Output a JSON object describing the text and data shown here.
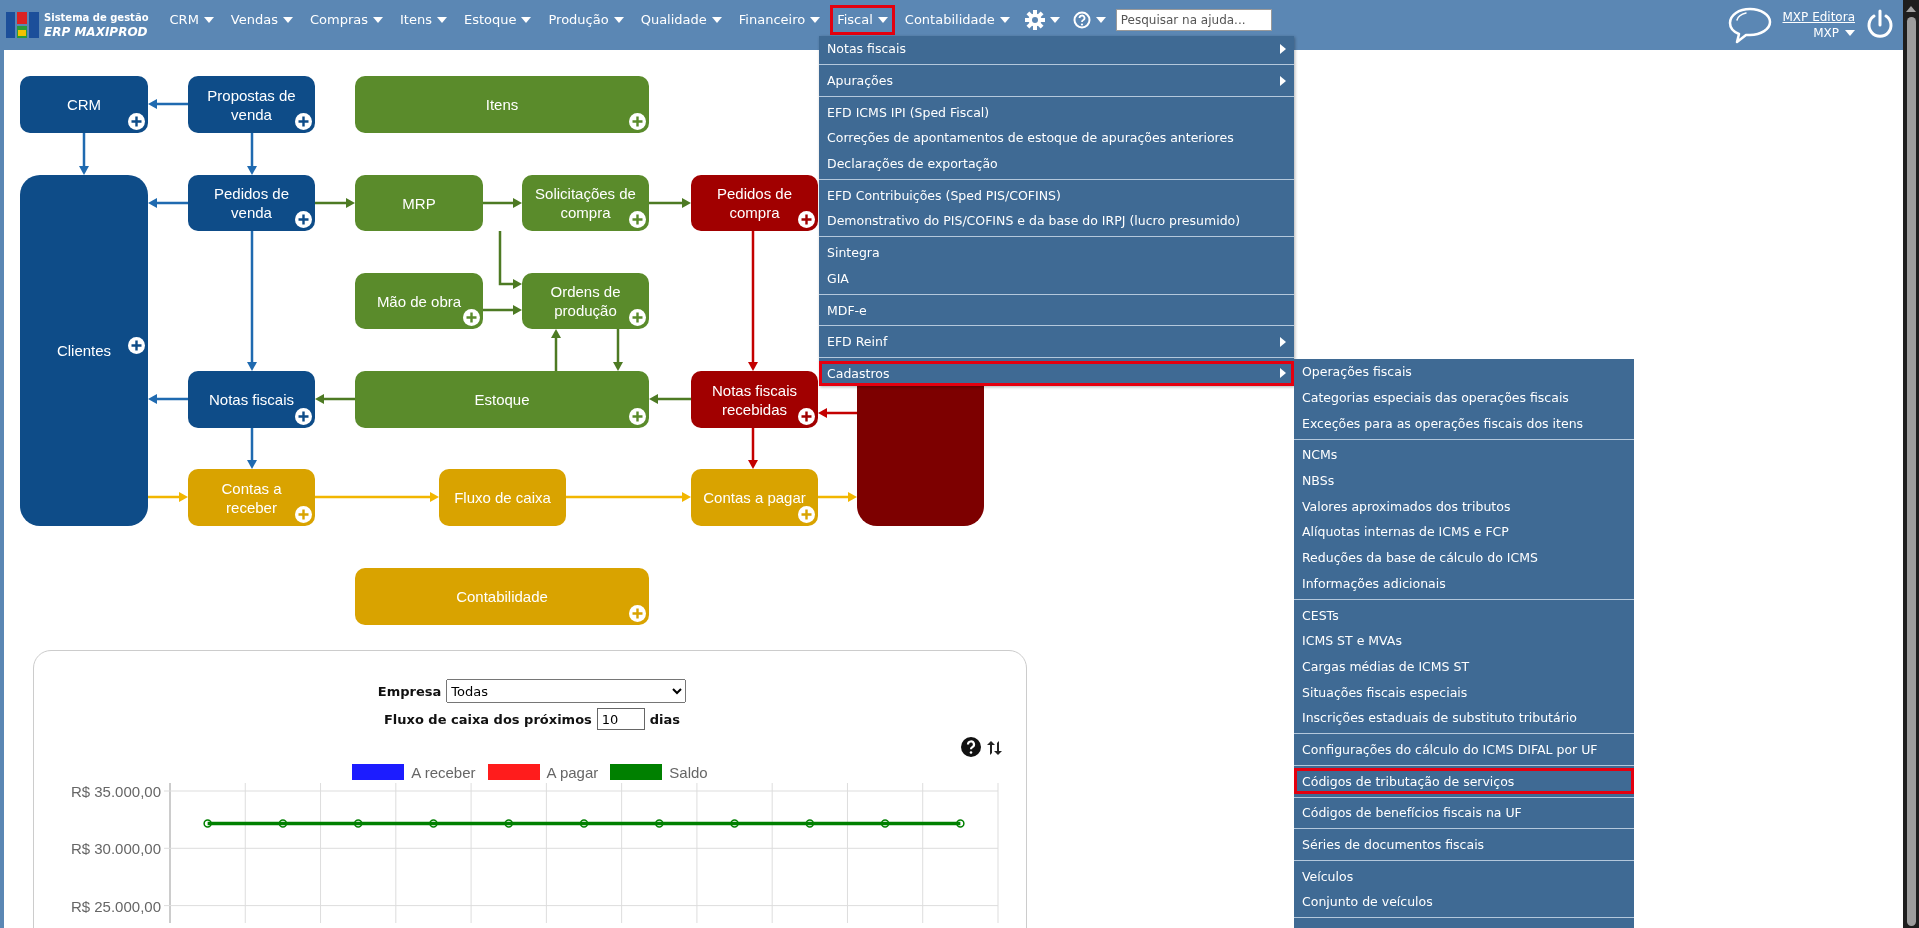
{
  "logo": {
    "subtitle": "Sistema de gestão",
    "title": "ERP MAXIPROD"
  },
  "nav": [
    {
      "label": "CRM",
      "selected": false
    },
    {
      "label": "Vendas",
      "selected": false
    },
    {
      "label": "Compras",
      "selected": false
    },
    {
      "label": "Itens",
      "selected": false
    },
    {
      "label": "Estoque",
      "selected": false
    },
    {
      "label": "Produção",
      "selected": false
    },
    {
      "label": "Qualidade",
      "selected": false
    },
    {
      "label": "Financeiro",
      "selected": false
    },
    {
      "label": "Fiscal",
      "selected": true
    },
    {
      "label": "Contabilidade",
      "selected": false
    }
  ],
  "search": {
    "placeholder": "Pesquisar na ajuda..."
  },
  "user": {
    "name": "MXP Editora",
    "company": "MXP"
  },
  "nodes": [
    {
      "label": "CRM",
      "color": "#0e4c88",
      "add": true
    },
    {
      "label": "Propostas de venda",
      "color": "#0e4c88",
      "add": true
    },
    {
      "label": "Itens",
      "color": "#5a8b2b",
      "add": true
    },
    {
      "label": "Clientes",
      "color": "#0e4c88",
      "add": true
    },
    {
      "label": "Pedidos de venda",
      "color": "#0e4c88",
      "add": true
    },
    {
      "label": "MRP",
      "color": "#5a8b2b",
      "add": false
    },
    {
      "label": "Solicitações de compra",
      "color": "#5a8b2b",
      "add": true
    },
    {
      "label": "Pedidos de compra",
      "color": "#a10000",
      "add": true
    },
    {
      "label": "Mão de obra",
      "color": "#5a8b2b",
      "add": true
    },
    {
      "label": "Ordens de produção",
      "color": "#5a8b2b",
      "add": true
    },
    {
      "label": "Notas fiscais",
      "color": "#0e4c88",
      "add": true
    },
    {
      "label": "Estoque",
      "color": "#5a8b2b",
      "add": true
    },
    {
      "label": "Notas fiscais recebidas",
      "color": "#a10000",
      "add": true
    },
    {
      "color": "#7d0000",
      "add": false
    },
    {
      "label": "Contas a receber",
      "color": "#d9a300",
      "add": true
    },
    {
      "label": "Fluxo de caixa",
      "color": "#d9a300",
      "add": false
    },
    {
      "label": "Contas a pagar",
      "color": "#d9a300",
      "add": true
    },
    {
      "label": "Contabilidade",
      "color": "#d9a300",
      "add": true
    }
  ],
  "cashflow": {
    "company_label": "Empresa",
    "company_value": "Todas",
    "days_label": "Fluxo de caixa dos próximos",
    "days_value": "10",
    "days_unit": "dias",
    "legend": [
      {
        "name": "A receber",
        "color": "#1c1cff"
      },
      {
        "name": "A pagar",
        "color": "#ff1c1c"
      },
      {
        "name": "Saldo",
        "color": "#008000"
      }
    ],
    "y_axis_labels": [
      "R$ 35.000,00",
      "R$ 30.000,00",
      "R$ 25.000,00"
    ]
  },
  "fiscal_menu": {
    "groups": [
      [
        {
          "label": "Notas fiscais",
          "arrow": true,
          "selected": false
        }
      ],
      [
        {
          "label": "Apurações",
          "arrow": true,
          "selected": false
        }
      ],
      [
        {
          "label": "EFD ICMS IPI (Sped Fiscal)",
          "arrow": false,
          "selected": false
        },
        {
          "label": "Correções de apontamentos de estoque de apurações anteriores",
          "arrow": false,
          "selected": false
        },
        {
          "label": "Declarações de exportação",
          "arrow": false,
          "selected": false
        }
      ],
      [
        {
          "label": "EFD Contribuições (Sped PIS/COFINS)",
          "arrow": false,
          "selected": false
        },
        {
          "label": "Demonstrativo do PIS/COFINS e da base do IRPJ (lucro presumido)",
          "arrow": false,
          "selected": false
        }
      ],
      [
        {
          "label": "Sintegra",
          "arrow": false,
          "selected": false
        },
        {
          "label": "GIA",
          "arrow": false,
          "selected": false
        }
      ],
      [
        {
          "label": "MDF-e",
          "arrow": false,
          "selected": false
        }
      ],
      [
        {
          "label": "EFD Reinf",
          "arrow": true,
          "selected": false
        }
      ],
      [
        {
          "label": "Cadastros",
          "arrow": true,
          "selected": true
        }
      ]
    ]
  },
  "cadastros_menu": {
    "groups": [
      [
        {
          "label": "Operações fiscais",
          "selected": false
        },
        {
          "label": "Categorias especiais das operações fiscais",
          "selected": false
        },
        {
          "label": "Exceções para as operações fiscais dos itens",
          "selected": false
        }
      ],
      [
        {
          "label": "NCMs",
          "selected": false
        },
        {
          "label": "NBSs",
          "selected": false
        },
        {
          "label": "Valores aproximados dos tributos",
          "selected": false
        },
        {
          "label": "Alíquotas internas de ICMS e FCP",
          "selected": false
        },
        {
          "label": "Reduções da base de cálculo do ICMS",
          "selected": false
        },
        {
          "label": "Informações adicionais",
          "selected": false
        }
      ],
      [
        {
          "label": "CESTs",
          "selected": false
        },
        {
          "label": "ICMS ST e MVAs",
          "selected": false
        },
        {
          "label": "Cargas médias de ICMS ST",
          "selected": false
        },
        {
          "label": "Situações fiscais especiais",
          "selected": false
        },
        {
          "label": "Inscrições estaduais de substituto tributário",
          "selected": false
        }
      ],
      [
        {
          "label": "Configurações do cálculo do ICMS DIFAL por UF",
          "selected": false
        }
      ],
      [
        {
          "label": "Códigos de tributação de serviços",
          "selected": true
        }
      ],
      [
        {
          "label": "Códigos de benefícios fiscais na UF",
          "selected": false
        }
      ],
      [
        {
          "label": "Séries de documentos fiscais",
          "selected": false
        }
      ],
      [
        {
          "label": "Veículos",
          "selected": false
        },
        {
          "label": "Conjunto de veículos",
          "selected": false
        }
      ]
    ]
  }
}
